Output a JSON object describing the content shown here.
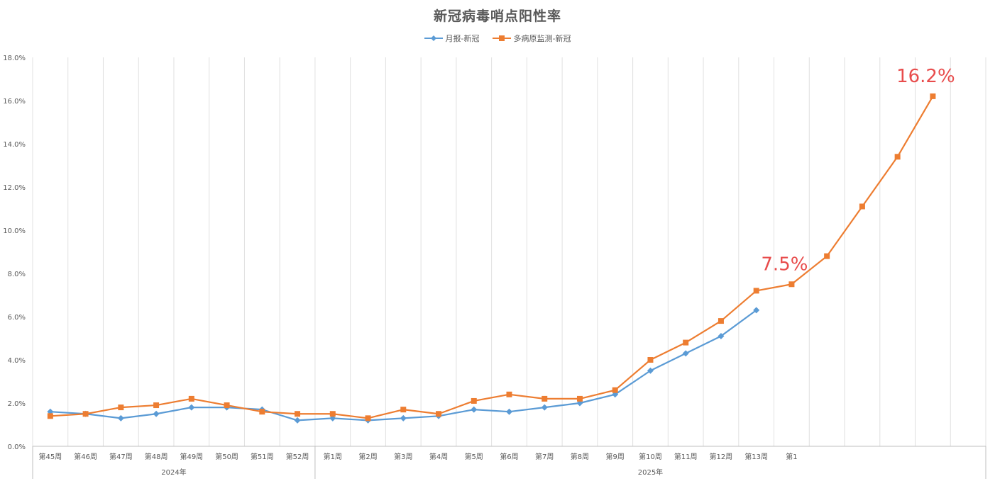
{
  "chart_data": {
    "type": "line",
    "title": "新冠病毒哨点阳性率",
    "categories": [
      "第45周",
      "第46周",
      "第47周",
      "第48周",
      "第49周",
      "第50周",
      "第51周",
      "第52周",
      "第1周",
      "第2周",
      "第3周",
      "第4周",
      "第5周",
      "第6周",
      "第7周",
      "第8周",
      "第9周",
      "第10周",
      "第11周",
      "第12周",
      "第13周",
      "第1",
      "",
      "",
      "",
      "",
      ""
    ],
    "groups": [
      {
        "label": "2024年",
        "from": 0,
        "to": 7
      },
      {
        "label": "2025年",
        "from": 8,
        "to": 26
      }
    ],
    "ylim": [
      0,
      18
    ],
    "yticks": [
      0,
      2,
      4,
      6,
      8,
      10,
      12,
      14,
      16,
      18
    ],
    "ytick_labels": [
      "0.0%",
      "2.0%",
      "4.0%",
      "6.0%",
      "8.0%",
      "10.0%",
      "12.0%",
      "14.0%",
      "16.0%",
      "18.0%"
    ],
    "legend_position": "top",
    "grid": "vertical",
    "series": [
      {
        "name": "月报-新冠",
        "color": "#5b9bd5",
        "marker": "diamond",
        "values": [
          1.6,
          1.5,
          1.3,
          1.5,
          1.8,
          1.8,
          1.7,
          1.2,
          1.3,
          1.2,
          1.3,
          1.4,
          1.7,
          1.6,
          1.8,
          2.0,
          2.4,
          3.5,
          4.3,
          5.1,
          6.3,
          null,
          null,
          null,
          null,
          null,
          null
        ]
      },
      {
        "name": "多病原监测-新冠",
        "color": "#ed7d31",
        "marker": "square",
        "values": [
          1.4,
          1.5,
          1.8,
          1.9,
          2.2,
          1.9,
          1.6,
          1.5,
          1.5,
          1.3,
          1.7,
          1.5,
          2.1,
          2.4,
          2.2,
          2.2,
          2.6,
          4.0,
          4.8,
          5.8,
          7.2,
          7.5,
          8.8,
          11.1,
          13.4,
          16.2
        ]
      }
    ],
    "annotations": [
      {
        "text": "7.5%",
        "series": 1,
        "index": 21,
        "color": "#e84c4c"
      },
      {
        "text": "16.2%",
        "series": 1,
        "index": 25,
        "color": "#e84c4c"
      }
    ]
  }
}
